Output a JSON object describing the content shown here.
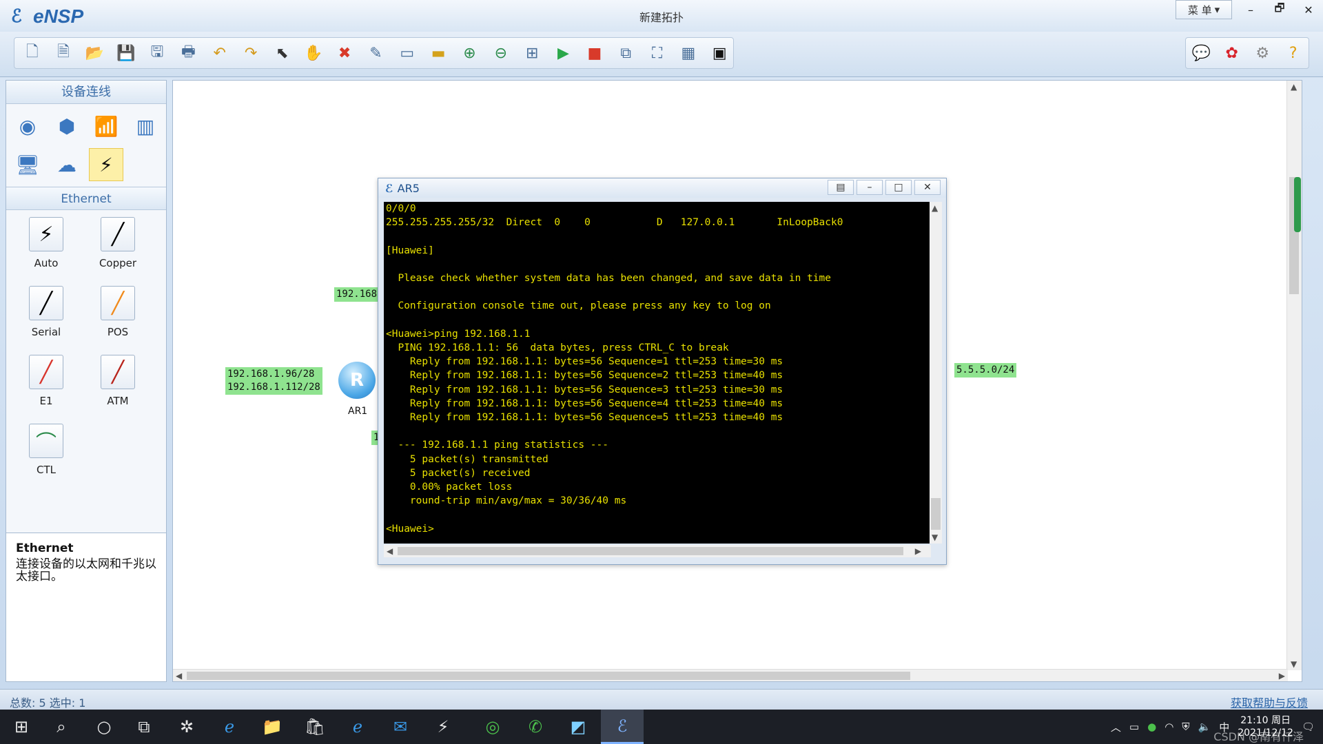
{
  "app": {
    "name": "eNSP",
    "window_title": "新建拓扑",
    "menu_label": "菜 单",
    "minimize": "–",
    "restore": "🗗",
    "close": "✕"
  },
  "left_panel": {
    "devices_title": "设备连线",
    "cables_title": "Ethernet",
    "cables": [
      {
        "label": "Auto",
        "glyph": "⚡",
        "color": "#000000"
      },
      {
        "label": "Copper",
        "glyph": "╱",
        "color": "#000000"
      },
      {
        "label": "Serial",
        "glyph": "╱",
        "color": "#000000"
      },
      {
        "label": "POS",
        "glyph": "╱",
        "color": "#f08a1c"
      },
      {
        "label": "E1",
        "glyph": "╱",
        "color": "#d8342c"
      },
      {
        "label": "ATM",
        "glyph": "╱",
        "color": "#b8241c"
      },
      {
        "label": "CTL",
        "glyph": "⌒",
        "color": "#2a8a4a"
      }
    ],
    "description_title": "Ethernet",
    "description_text": "连接设备的以太网和千兆以太接口。"
  },
  "canvas": {
    "labels": {
      "label1": "192.168",
      "label2_line1": "192.168.1.96/28",
      "label2_line2": "192.168.1.112/28",
      "label3": "5.5.5.0/24",
      "label4": "1"
    },
    "router_name": "AR1",
    "router_glyph": "R"
  },
  "terminal": {
    "title": "AR5",
    "lines": [
      "0/0/0",
      "255.255.255.255/32  Direct  0    0           D   127.0.0.1       InLoopBack0",
      "",
      "[Huawei]",
      "",
      "  Please check whether system data has been changed, and save data in time",
      "",
      "  Configuration console time out, please press any key to log on",
      "",
      "<Huawei>ping 192.168.1.1",
      "  PING 192.168.1.1: 56  data bytes, press CTRL_C to break",
      "    Reply from 192.168.1.1: bytes=56 Sequence=1 ttl=253 time=30 ms",
      "    Reply from 192.168.1.1: bytes=56 Sequence=2 ttl=253 time=40 ms",
      "    Reply from 192.168.1.1: bytes=56 Sequence=3 ttl=253 time=30 ms",
      "    Reply from 192.168.1.1: bytes=56 Sequence=4 ttl=253 time=40 ms",
      "    Reply from 192.168.1.1: bytes=56 Sequence=5 ttl=253 time=40 ms",
      "",
      "  --- 192.168.1.1 ping statistics ---",
      "    5 packet(s) transmitted",
      "    5 packet(s) received",
      "    0.00% packet loss",
      "    round-trip min/avg/max = 30/36/40 ms",
      "",
      "<Huawei>"
    ]
  },
  "statusbar": {
    "left": "总数: 5  选中: 1",
    "right": "获取帮助与反馈"
  },
  "taskbar": {
    "clock_time": "21:10 周日",
    "clock_date": "2021/12/12",
    "ime": "中",
    "watermark": "CSDN @南有仟泽"
  }
}
